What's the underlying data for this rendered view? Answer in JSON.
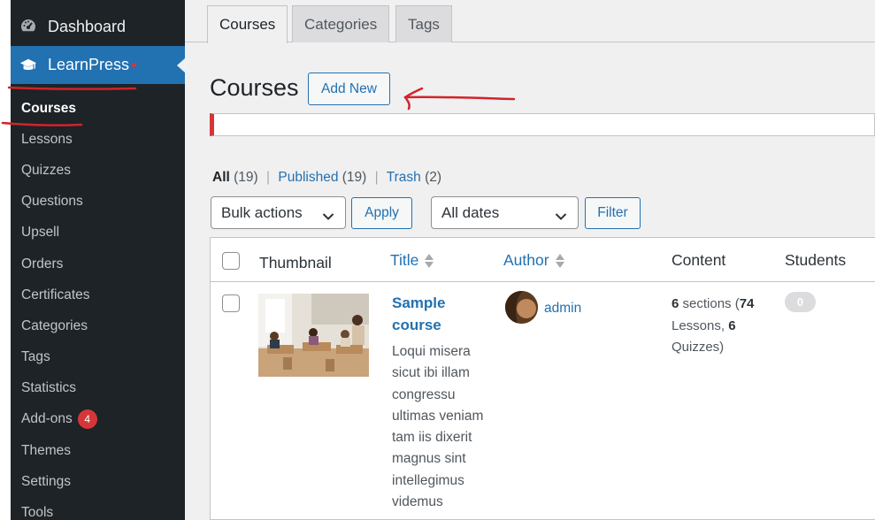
{
  "sidebar": {
    "dashboard_label": "Dashboard",
    "learnpress_label": "LearnPress",
    "items": [
      {
        "label": "Courses",
        "current": true
      },
      {
        "label": "Lessons"
      },
      {
        "label": "Quizzes"
      },
      {
        "label": "Questions"
      },
      {
        "label": "Upsell"
      },
      {
        "label": "Orders"
      },
      {
        "label": "Certificates"
      },
      {
        "label": "Categories"
      },
      {
        "label": "Tags"
      },
      {
        "label": "Statistics"
      },
      {
        "label": "Add-ons",
        "badge": "4"
      },
      {
        "label": "Themes"
      },
      {
        "label": "Settings"
      },
      {
        "label": "Tools"
      }
    ]
  },
  "tabs": [
    {
      "label": "Courses",
      "active": true
    },
    {
      "label": "Categories"
    },
    {
      "label": "Tags"
    }
  ],
  "page": {
    "title": "Courses",
    "add_new_label": "Add New"
  },
  "filters": {
    "all_label": "All",
    "all_count": "(19)",
    "published_label": "Published",
    "published_count": "(19)",
    "trash_label": "Trash",
    "trash_count": "(2)",
    "separator": "|",
    "bulk_actions_value": "Bulk actions",
    "apply_label": "Apply",
    "dates_value": "All dates",
    "filter_label": "Filter"
  },
  "table": {
    "columns": {
      "thumbnail": "Thumbnail",
      "title": "Title",
      "author": "Author",
      "content": "Content",
      "students": "Students"
    },
    "rows": [
      {
        "title": "Sample course",
        "description": "Loqui misera sicut ibi illam congressu ultimas veniam tam iis dixerit magnus sint intellegimus videmus",
        "author": "admin",
        "content_sections": "6",
        "content_sections_text": " sections (",
        "content_lessons": "74",
        "content_lessons_text": " Lessons, ",
        "content_quizzes": "6",
        "content_quizzes_text": " Quizzes)",
        "students": "0"
      }
    ]
  },
  "colors": {
    "sidebar_bg": "#1d2327",
    "accent": "#2271b1",
    "badge": "#d63638",
    "annotation": "#d2232a"
  }
}
